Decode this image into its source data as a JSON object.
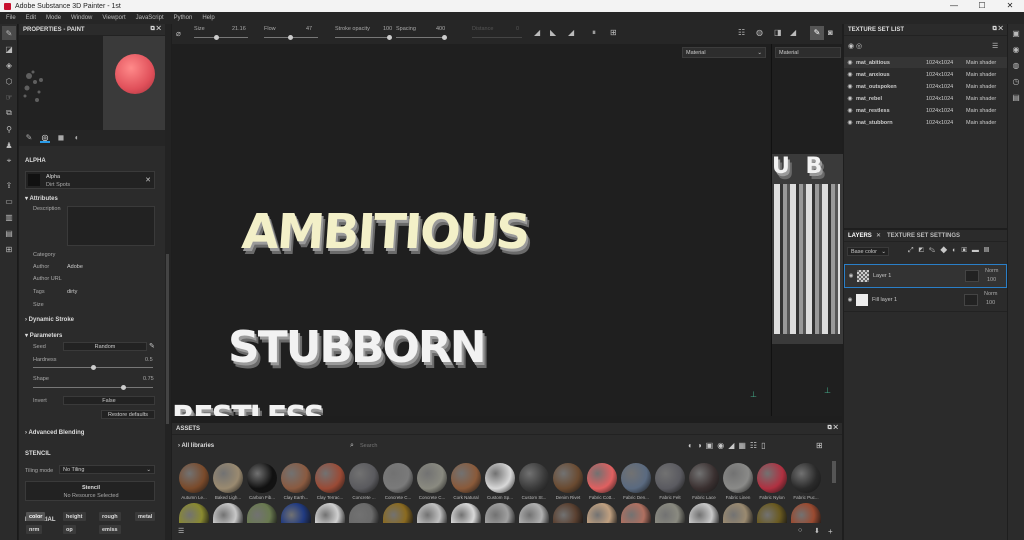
{
  "window": {
    "title": "Adobe Substance 3D Painter - 1st",
    "minimize": "—",
    "maximize": "☐",
    "close": "✕"
  },
  "menu": [
    "File",
    "Edit",
    "Mode",
    "Window",
    "Viewport",
    "JavaScript",
    "Python",
    "Help"
  ],
  "properties": {
    "title": "PROPERTIES - PAINT",
    "alpha_section": "ALPHA",
    "alpha_name": "Alpha",
    "alpha_value": "Dirt Spots",
    "attributes": "Attributes",
    "description_label": "Description",
    "category_label": "Category",
    "author_label": "Author",
    "author_value": "Adobe",
    "author_url_label": "Author URL",
    "tags_label": "Tags",
    "tags_value": "dirty",
    "size_label": "Size",
    "dynamic_stroke": "Dynamic Stroke",
    "parameters": "Parameters",
    "seed_label": "Seed",
    "seed_value": "Random",
    "hardness_label": "Hardness",
    "hardness_value": "0.5",
    "hardness_level": 0.5,
    "shape_label": "Shape",
    "shape_value": "0.75",
    "shape_level": 0.75,
    "invert_label": "Invert",
    "invert_value": "False",
    "restore": "Restore defaults",
    "advanced_blending": "Advanced Blending",
    "stencil_section": "STENCIL",
    "tiling_label": "Tiling mode",
    "tiling_value": "No Tiling",
    "stencil_name": "Stencil",
    "stencil_value": "No Resource Selected",
    "material_section": "MATERIAL",
    "material_chips": [
      "color",
      "height",
      "rough",
      "metal",
      "nrm",
      "op",
      "emiss"
    ]
  },
  "toolbar": {
    "size_label": "Size",
    "size_value": "21.16",
    "flow_label": "Flow",
    "flow_value": "47",
    "stroke_opacity_label": "Stroke opacity",
    "stroke_opacity_value": "100",
    "spacing_label": "Spacing",
    "spacing_value": "400",
    "distance_label": "Distance",
    "distance_value": "0"
  },
  "viewport": {
    "material_left": "Material",
    "material_right": "Material",
    "words": [
      "AMBITIOUS",
      "STUBBORN",
      "RESTLESS"
    ],
    "uv_word": "U B"
  },
  "texture_set_list": {
    "title": "TEXTURE SET LIST",
    "rows": [
      {
        "name": "mat_abitious",
        "res": "1024x1024",
        "shader": "Main shader"
      },
      {
        "name": "mat_anxious",
        "res": "1024x1024",
        "shader": "Main shader"
      },
      {
        "name": "mat_outspoken",
        "res": "1024x1024",
        "shader": "Main shader"
      },
      {
        "name": "mat_rebel",
        "res": "1024x1024",
        "shader": "Main shader"
      },
      {
        "name": "mat_restless",
        "res": "1024x1024",
        "shader": "Main shader"
      },
      {
        "name": "mat_stubborn",
        "res": "1024x1024",
        "shader": "Main shader"
      }
    ]
  },
  "layers": {
    "tab_layers": "LAYERS",
    "tab_settings": "TEXTURE SET SETTINGS",
    "channel": "Base color",
    "rows": [
      {
        "name": "Layer 1",
        "blend": "Norm",
        "opacity": "100"
      },
      {
        "name": "Fill layer 1",
        "blend": "Norm",
        "opacity": "100"
      }
    ]
  },
  "assets": {
    "title": "ASSETS",
    "library": "All libraries",
    "search_placeholder": "Search",
    "items": [
      {
        "label": "Autumn Le...",
        "color": "#7a4a2a"
      },
      {
        "label": "Baked Ligh...",
        "color": "#9a8a70"
      },
      {
        "label": "Carbon Fib...",
        "color": "#111111"
      },
      {
        "label": "Clay Earth...",
        "color": "#8a5a40"
      },
      {
        "label": "Clay Terrac...",
        "color": "#9a4a35"
      },
      {
        "label": "Concrete ...",
        "color": "#5a5a5e"
      },
      {
        "label": "Concrete C...",
        "color": "#7a7a7a"
      },
      {
        "label": "Concrete C...",
        "color": "#8a8a80"
      },
      {
        "label": "Cork Natural",
        "color": "#8a5a3a"
      },
      {
        "label": "Custom Sp...",
        "color": "#d8d8d8"
      },
      {
        "label": "Custom St...",
        "color": "#3a3a3a"
      },
      {
        "label": "Denim Rivet",
        "color": "#6a4a30"
      },
      {
        "label": "Fabric Cott...",
        "color": "#e06060"
      },
      {
        "label": "Fabric Den...",
        "color": "#5a6a80"
      },
      {
        "label": "Fabric Felt",
        "color": "#5a5a60"
      },
      {
        "label": "Fabric Lace",
        "color": "#3a3030"
      },
      {
        "label": "Fabric Linen",
        "color": "#8a8a88"
      },
      {
        "label": "Fabric Nylon",
        "color": "#b03040"
      },
      {
        "label": "Fabric Puc...",
        "color": "#2a2a2a"
      }
    ],
    "row2_colors": [
      "#8a8a30",
      "#c8c8c8",
      "#6a7a50",
      "#203a80",
      "#d0d0d0",
      "#6a6a6a",
      "#8a6a20",
      "#c0c0c0",
      "#d8d8d8",
      "#a0a0a0",
      "#b0b0b0",
      "#5a4030",
      "#c0a080",
      "#b07060",
      "#8a8a80",
      "#c8c8c8",
      "#9a8a70",
      "#6a5a20",
      "#9a4a30"
    ]
  }
}
